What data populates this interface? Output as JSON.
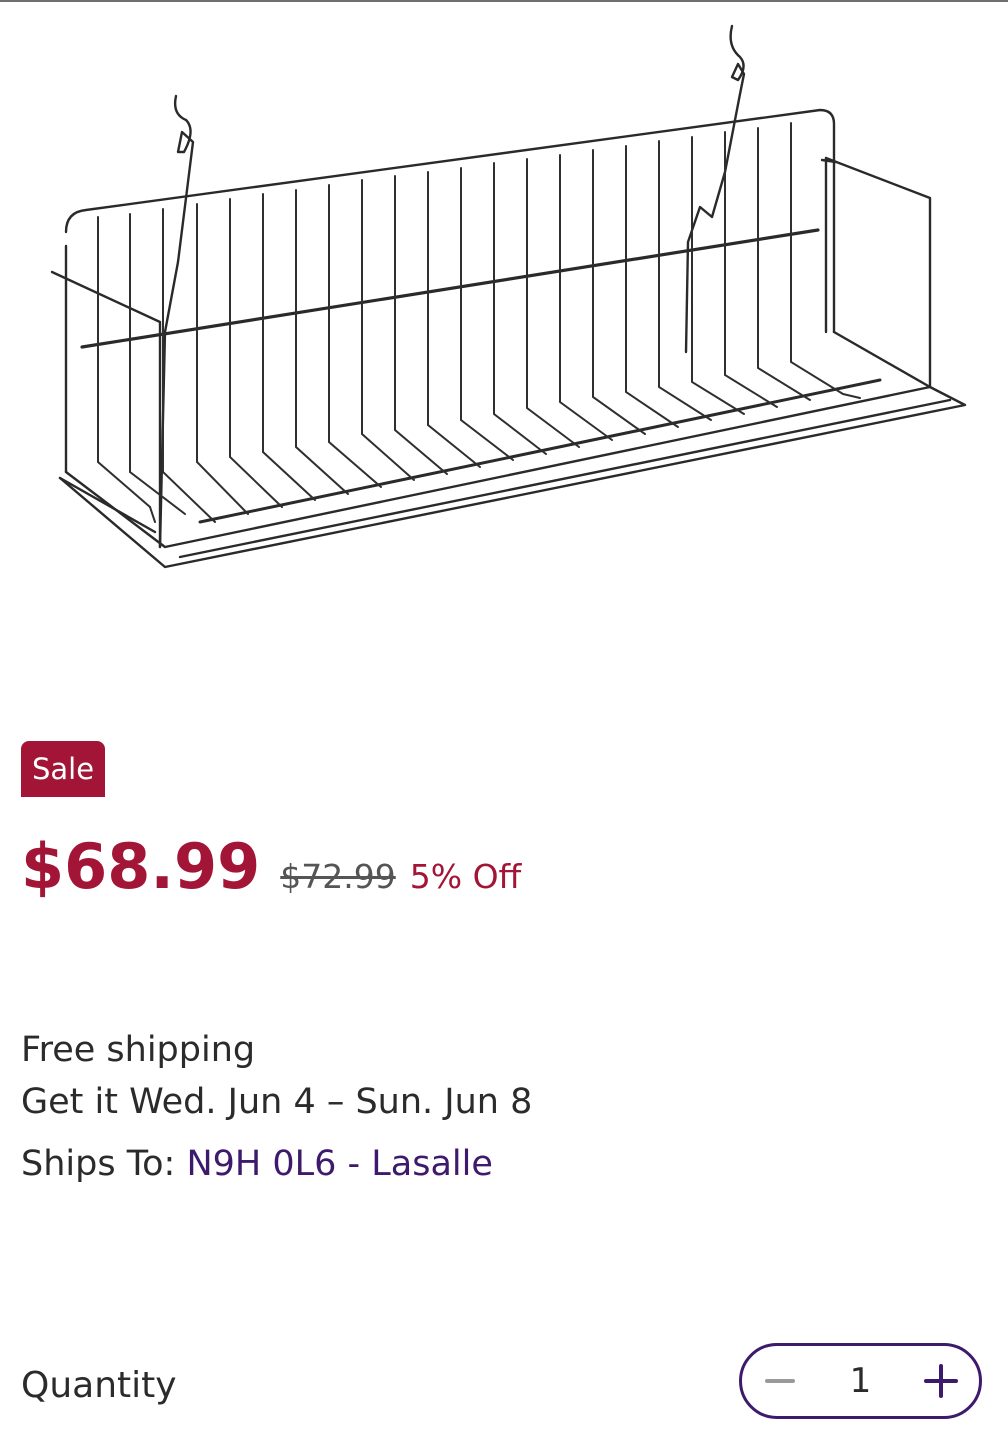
{
  "product": {
    "image_alt": "wire shelf",
    "sale_badge": "Sale",
    "price": {
      "current": "$68.99",
      "original": "$72.99",
      "discount": "5% Off"
    }
  },
  "shipping": {
    "free_label": "Free shipping",
    "delivery_estimate": "Get it Wed. Jun 4 – Sun. Jun 8",
    "ships_to_label": "Ships To:",
    "ships_to_location": "N9H 0L6 - Lasalle"
  },
  "quantity": {
    "label": "Quantity",
    "value": "1",
    "decrement_icon": "minus-icon",
    "increment_icon": "plus-icon"
  },
  "colors": {
    "sale": "#a31536",
    "link": "#3e1a6c",
    "text": "#2b2b2b"
  }
}
